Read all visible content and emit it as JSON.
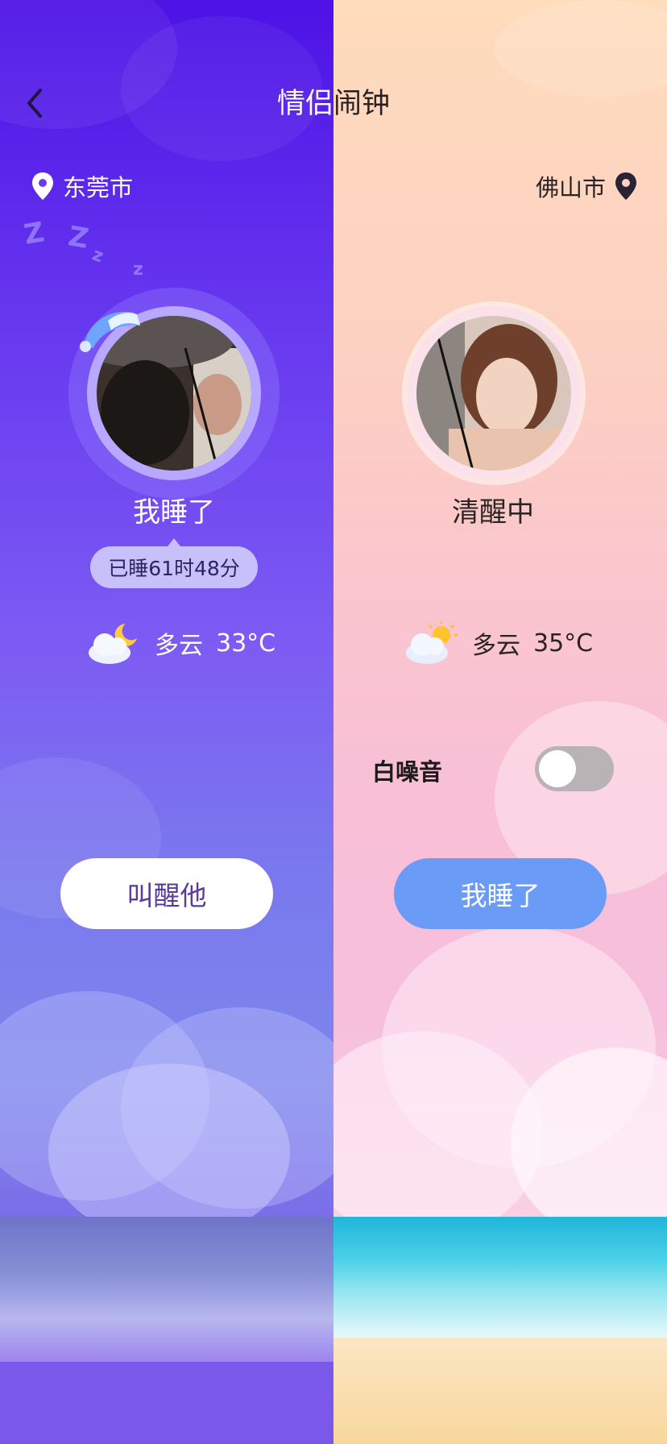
{
  "header": {
    "title": "情侣闹钟",
    "back_icon": "chevron-left-icon"
  },
  "left": {
    "city": "东莞市",
    "status": "我睡了",
    "sleep_duration": "已睡61时48分",
    "weather": {
      "condition": "多云",
      "temp": "33°C",
      "icon": "cloud-moon-icon"
    },
    "action_button": "叫醒他"
  },
  "right": {
    "city": "佛山市",
    "status": "清醒中",
    "weather": {
      "condition": "多云",
      "temp": "35°C",
      "icon": "cloud-sun-icon"
    },
    "white_noise_label": "白噪音",
    "white_noise_on": false,
    "action_button": "我睡了"
  }
}
